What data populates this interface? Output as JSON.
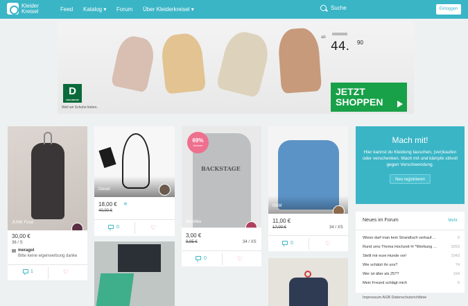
{
  "nav": {
    "logo_text": "Kleider Kreisel",
    "links": [
      "Feed",
      "Katalog ▾",
      "Forum",
      "Über Kleiderkreisel ▾"
    ],
    "search_label": "Suche",
    "login_label": "Einloggen",
    "color": "#3ab5c6"
  },
  "banner": {
    "brand_letter": "D",
    "brand_small": "DEICHMANN",
    "tagline": "Weil wir Schuhe lieben.",
    "price_prefix": "ab",
    "price": "44.",
    "price_cents": "90",
    "cta": "JETZT SHOPPEN"
  },
  "items": [
    {
      "brand": "JUNK Food",
      "price": "30,00 €",
      "size": "36 / S",
      "user": "meragol",
      "comment_text": "Bitte keine eigenwerbung danke",
      "comments": "1"
    },
    {
      "brand": "Diesel",
      "price": "18,00 €",
      "old_price": "40,00 €",
      "comments": "0"
    },
    {
      "brand": "Bershka",
      "price": "3,00 €",
      "old_price": "9,95 €",
      "size": "34 / XS",
      "comments": "0",
      "badge": "69%",
      "badge_sub": "Autumn"
    },
    {
      "brand": "H&M",
      "price": "11,00 €",
      "old_price": "17,00 €",
      "size": "34 / XS",
      "comments": "0"
    }
  ],
  "machmit": {
    "title": "Mach mit!",
    "text": "Hier kannst du Kleidung tauschen, (ver)kaufen oder verschenken. Mach mit und kämpfe stilvoll gegen Verschwendung.",
    "button": "Neu registrieren"
  },
  "forum": {
    "title": "Neues im Forum",
    "more": "Mehr",
    "threads": [
      {
        "title": "Wieso darf man kein Strandtuch verkauf…",
        "count": "0"
      },
      {
        "title": "Rund ums Thema Hochzeit ✉ *Werbung …",
        "count": "3253"
      },
      {
        "title": "Stellt mir eure Hunde vor!",
        "count": "1043"
      },
      {
        "title": "Wie schätzt ihr uns?",
        "count": "74"
      },
      {
        "title": "Wer ist älter als 25??",
        "count": "154"
      },
      {
        "title": "Mein Freund schlägt mich",
        "count": "0"
      }
    ]
  },
  "footer": "Impressum  AGB  Datenschutzrichtlinie"
}
